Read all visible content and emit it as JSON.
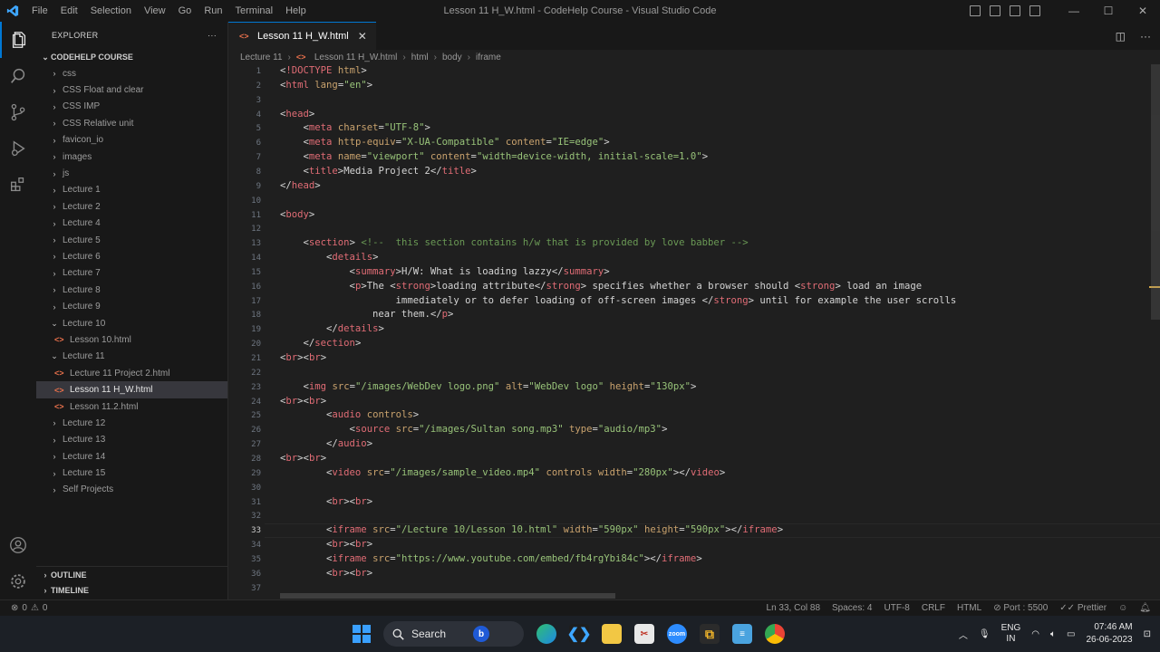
{
  "titlebar": {
    "menu": [
      "File",
      "Edit",
      "Selection",
      "View",
      "Go",
      "Run",
      "Terminal",
      "Help"
    ],
    "title": "Lesson 11 H_W.html - CodeHelp Course - Visual Studio Code",
    "controls": {
      "minimize": "—",
      "maximize": "☐",
      "close": "✕"
    }
  },
  "sidebar": {
    "header": "EXPLORER",
    "more": "···",
    "root": "CODEHELP COURSE",
    "items": [
      {
        "label": "css",
        "type": "folder",
        "open": false
      },
      {
        "label": "CSS Float and clear",
        "type": "folder",
        "open": false
      },
      {
        "label": "CSS IMP",
        "type": "folder",
        "open": false
      },
      {
        "label": "CSS Relative unit",
        "type": "folder",
        "open": false
      },
      {
        "label": "favicon_io",
        "type": "folder",
        "open": false
      },
      {
        "label": "images",
        "type": "folder",
        "open": false
      },
      {
        "label": "js",
        "type": "folder",
        "open": false
      },
      {
        "label": "Lecture 1",
        "type": "folder",
        "open": false
      },
      {
        "label": "Lecture 2",
        "type": "folder",
        "open": false
      },
      {
        "label": "Lecture 4",
        "type": "folder",
        "open": false
      },
      {
        "label": "Lecture 5",
        "type": "folder",
        "open": false
      },
      {
        "label": "Lecture 6",
        "type": "folder",
        "open": false
      },
      {
        "label": "Lecture 7",
        "type": "folder",
        "open": false
      },
      {
        "label": "Lecture 8",
        "type": "folder",
        "open": false
      },
      {
        "label": "Lecture 9",
        "type": "folder",
        "open": false
      },
      {
        "label": "Lecture 10",
        "type": "folder",
        "open": true
      },
      {
        "label": "Lesson 10.html",
        "type": "file",
        "depth": 2
      },
      {
        "label": "Lecture 11",
        "type": "folder",
        "open": true
      },
      {
        "label": "Lecture 11 Project 2.html",
        "type": "file",
        "depth": 2
      },
      {
        "label": "Lesson 11 H_W.html",
        "type": "file",
        "depth": 2,
        "selected": true
      },
      {
        "label": "Lesson 11.2.html",
        "type": "file",
        "depth": 2
      },
      {
        "label": "Lecture 12",
        "type": "folder",
        "open": false
      },
      {
        "label": "Lecture 13",
        "type": "folder",
        "open": false
      },
      {
        "label": "Lecture 14",
        "type": "folder",
        "open": false
      },
      {
        "label": "Lecture 15",
        "type": "folder",
        "open": false
      },
      {
        "label": "Self Projects",
        "type": "folder",
        "open": false
      }
    ],
    "outline": "OUTLINE",
    "timeline": "TIMELINE"
  },
  "editor": {
    "tab": "Lesson 11 H_W.html",
    "breadcrumb": [
      "Lecture 11",
      "Lesson 11 H_W.html",
      "html",
      "body",
      "iframe"
    ],
    "active_line": 33,
    "lines": [
      "<!DOCTYPE html>",
      "<html lang=\"en\">",
      "",
      "<head>",
      "    <meta charset=\"UTF-8\">",
      "    <meta http-equiv=\"X-UA-Compatible\" content=\"IE=edge\">",
      "    <meta name=\"viewport\" content=\"width=device-width, initial-scale=1.0\">",
      "    <title>Media Project 2</title>",
      "</head>",
      "",
      "<body>",
      "",
      "    <section> <!--  this section contains h/w that is provided by love babber -->",
      "        <details>",
      "            <summary>H/W: What is loading lazzy</summary>",
      "            <p>The <strong>loading attribute</strong> specifies whether a browser should <strong> load an image",
      "                    immediately or to defer loading of off-screen images </strong> until for example the user scrolls",
      "                near them.</p>",
      "        </details>",
      "    </section>",
      "<br><br>",
      "",
      "    <img src=\"/images/WebDev logo.png\" alt=\"WebDev logo\" height=\"130px\">",
      "<br><br>",
      "        <audio controls>",
      "            <source src=\"/images/Sultan song.mp3\" type=\"audio/mp3\">",
      "        </audio>",
      "<br><br>",
      "        <video src=\"/images/sample_video.mp4\" controls width=\"280px\"></video>",
      "",
      "        <br><br>",
      "",
      "        <iframe src=\"/Lecture 10/Lesson 10.html\" width=\"590px\" height=\"590px\"></iframe>",
      "        <br><br>",
      "        <iframe src=\"https://www.youtube.com/embed/fb4rgYbi84c\"></iframe>",
      "        <br><br>",
      ""
    ]
  },
  "statusbar": {
    "errors": "0",
    "warnings": "0",
    "position": "Ln 33, Col 88",
    "spaces": "Spaces: 4",
    "encoding": "UTF-8",
    "eol": "CRLF",
    "language": "HTML",
    "port": "Port : 5500",
    "formatter": "Prettier"
  },
  "taskbar": {
    "search": "Search",
    "lang_top": "ENG",
    "lang_bottom": "IN",
    "time": "07:46 AM",
    "date": "26-06-2023"
  },
  "colors": {
    "accent": "#0078d4",
    "tag": "#e06c75",
    "attr": "#c9a26d",
    "value": "#98c379"
  }
}
